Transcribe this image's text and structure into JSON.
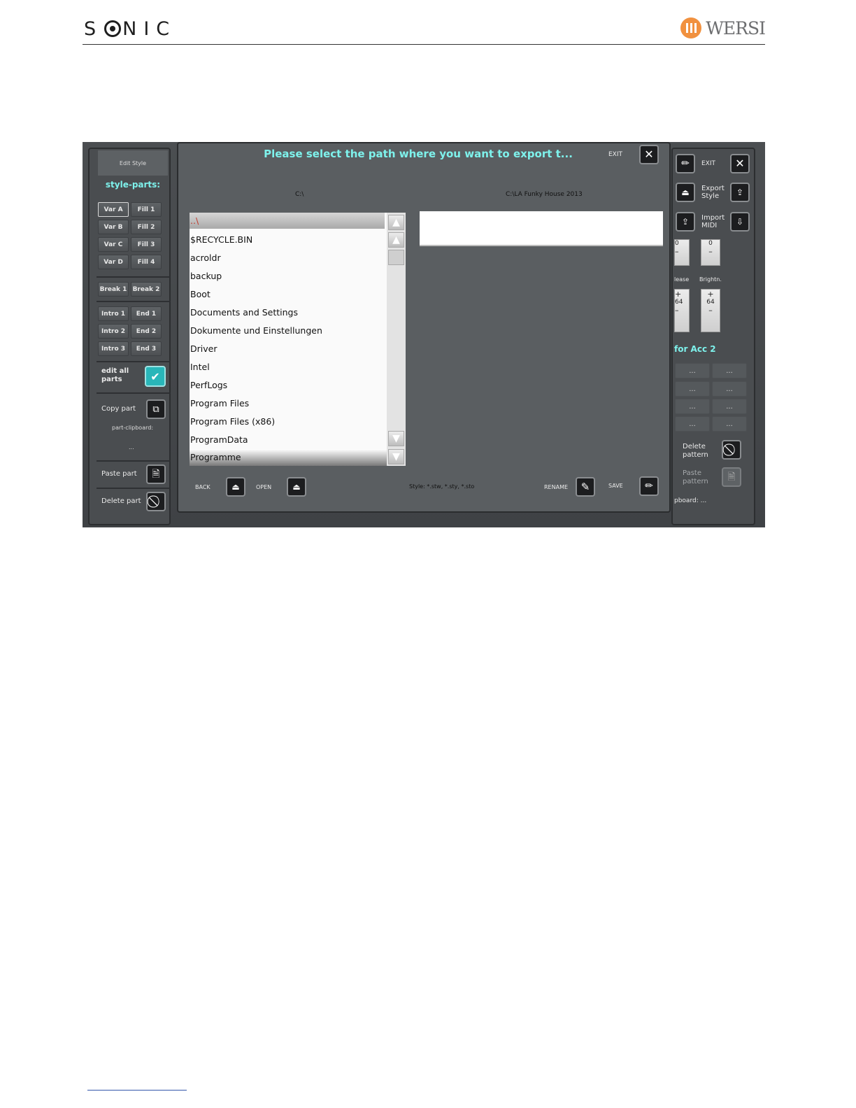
{
  "page": {
    "brand": "SONIC",
    "logo": "WERSI",
    "brand_color": "#f1913f"
  },
  "screen": {
    "left_panel": {
      "title": "Edit Style",
      "section_title": "style-parts:",
      "parts": [
        "Var A",
        "Fill 1",
        "Var B",
        "Fill 2",
        "Var C",
        "Fill 3",
        "Var D",
        "Fill 4"
      ],
      "breaks": [
        "Break 1",
        "Break 2"
      ],
      "intros_ends": [
        "Intro 1",
        "End 1",
        "Intro 2",
        "End 2",
        "Intro 3",
        "End 3"
      ],
      "edit_all": "edit all parts",
      "copy_part": "Copy part",
      "clipboard_label": "part-clipboard:",
      "clipboard_value": "...",
      "paste_part": "Paste part",
      "delete_part": "Delete part"
    },
    "dialog": {
      "title": "Please select the path where you want to export t...",
      "exit": "EXIT",
      "left_path": "C:\\",
      "right_path": "C:\\LA Funky House 2013",
      "files": [
        "..\\",
        "$RECYCLE.BIN",
        "acroldr",
        "backup",
        "Boot",
        "Documents and Settings",
        "Dokumente und Einstellungen",
        "Driver",
        "Intel",
        "PerfLogs",
        "Program Files",
        "Program Files (x86)",
        "ProgramData",
        "Programme"
      ],
      "back": "BACK",
      "open": "OPEN",
      "filter": "Style: *.stw, *.sty, *.sto",
      "rename": "RENAME",
      "save": "SAVE",
      "accent_color": "#7ef2ec"
    },
    "right_panel": {
      "exit": "EXIT",
      "export_style": "Export Style",
      "import_midi": "Import MIDI",
      "values_top": [
        "0",
        "0"
      ],
      "label_release": "lease",
      "label_brightn": "Brightn.",
      "values_bottom": [
        "64",
        "64"
      ],
      "acc_title": "for Acc 2",
      "cells": [
        "...",
        "...",
        "...",
        "...",
        "...",
        "...",
        "...",
        "..."
      ],
      "delete_pattern": "Delete pattern",
      "paste_pattern": "Paste pattern",
      "clipboard": "pboard: ..."
    }
  }
}
